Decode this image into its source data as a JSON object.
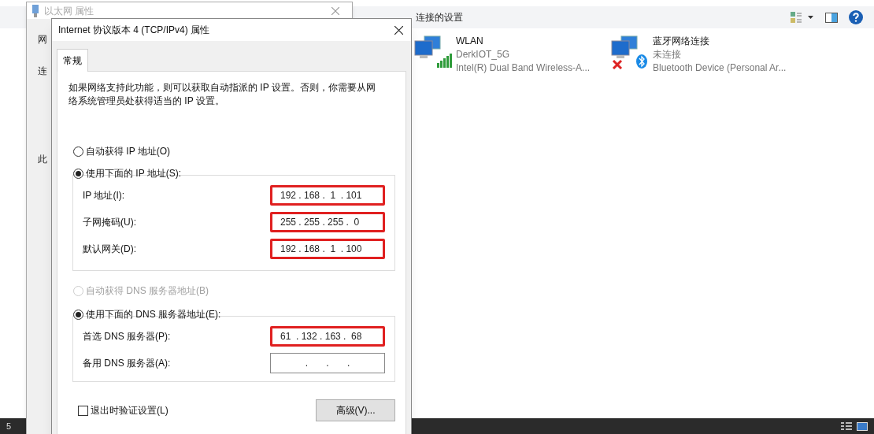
{
  "explorer": {
    "toolbar_text": "连接的设置",
    "connections": [
      {
        "name": "WLAN",
        "status": "DerkIOT_5G",
        "device": "Intel(R) Dual Band Wireless-A...",
        "kind": "wifi",
        "connected": true
      },
      {
        "name": "蓝牙网络连接",
        "status": "未连接",
        "device": "Bluetooth Device (Personal Ar...",
        "kind": "bluetooth",
        "connected": false
      }
    ],
    "status_bar": {
      "item_count": "5"
    }
  },
  "back_dialog": {
    "title": "以太网 属性",
    "tab": "网",
    "labels": [
      "连",
      "此"
    ]
  },
  "dialog": {
    "title": "Internet 协议版本 4 (TCP/IPv4) 属性",
    "tabs": [
      {
        "label": "常规",
        "selected": true
      }
    ],
    "description": "如果网络支持此功能，则可以获取自动指派的 IP 设置。否则，你需要从网络系统管理员处获得适当的 IP 设置。",
    "ip_options": [
      {
        "label": "自动获得 IP 地址(O)",
        "selected": false,
        "disabled": false
      },
      {
        "label": "使用下面的 IP 地址(S):",
        "selected": true,
        "disabled": false
      }
    ],
    "ip_fields": [
      {
        "label": "IP 地址(I):",
        "value": "192 . 168 .  1  . 101",
        "highlighted": true
      },
      {
        "label": "子网掩码(U):",
        "value": "255 . 255 . 255 .  0",
        "highlighted": true
      },
      {
        "label": "默认网关(D):",
        "value": "192 . 168 .  1  . 100",
        "highlighted": true
      }
    ],
    "dns_options": [
      {
        "label": "自动获得 DNS 服务器地址(B)",
        "selected": false,
        "disabled": true
      },
      {
        "label": "使用下面的 DNS 服务器地址(E):",
        "selected": true,
        "disabled": false
      }
    ],
    "dns_fields": [
      {
        "label": "首选 DNS 服务器(P):",
        "value": "61  . 132 . 163 .  68",
        "highlighted": true
      },
      {
        "label": "备用 DNS 服务器(A):",
        "value": ".       .       .",
        "highlighted": false
      }
    ],
    "validate": {
      "label": "退出时验证设置(L)",
      "checked": false
    },
    "advanced_button": "高级(V)..."
  }
}
